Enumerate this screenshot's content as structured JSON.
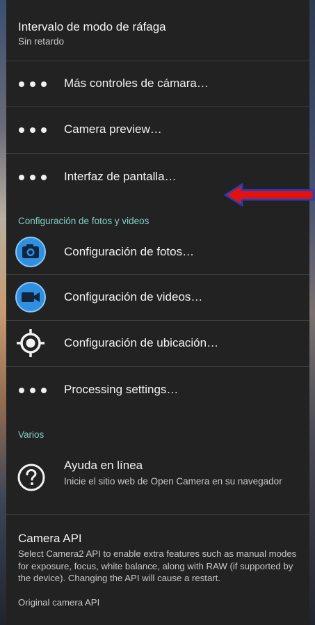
{
  "burst": {
    "title": "Intervalo de modo de ráfaga",
    "summary": "Sin retardo"
  },
  "menu_items": {
    "more_camera": "Más controles de cámara…",
    "camera_preview": "Camera preview…",
    "display_interface": "Interfaz de pantalla…"
  },
  "categories": {
    "photo_video": "Configuración de fotos y videos",
    "misc": "Varios"
  },
  "photo_video_items": {
    "photo": "Configuración de fotos…",
    "video": "Configuración de videos…",
    "location": "Configuración de ubicación…",
    "processing": "Processing settings…"
  },
  "help": {
    "title": "Ayuda en línea",
    "summary": "Inicie el sitio web de Open Camera en su navegador"
  },
  "camera_api": {
    "title": "Camera API",
    "summary": "Select Camera2 API to enable extra features such as manual modes for exposure, focus, white balance, along with RAW (if supported by the device). Changing the API will cause a restart.",
    "value": "Original camera API"
  },
  "icons": {
    "more": "three-dots-icon",
    "photo": "camera-icon",
    "video": "video-camera-icon",
    "location": "location-target-icon",
    "help": "help-circle-icon",
    "annotation": "red-arrow-icon"
  },
  "colors": {
    "background": "#222222",
    "accent": "#7ecfc8",
    "icon_blue": "#2f8fe0",
    "arrow_red": "#e01212",
    "arrow_outline": "#1f3fc0"
  }
}
